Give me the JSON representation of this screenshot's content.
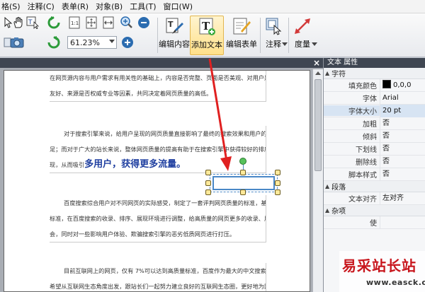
{
  "menu": [
    "格(S)",
    "注释(C)",
    "表单(R)",
    "对象(B)",
    "工具(T)",
    "窗口(W)"
  ],
  "toolbar": {
    "zoom_value": "61.23%",
    "buttons": [
      {
        "id": "edit-content",
        "label": "编辑内容"
      },
      {
        "id": "add-text",
        "label": "添加文本"
      },
      {
        "id": "edit-form",
        "label": "编辑表单"
      },
      {
        "id": "annotate",
        "label": "注释"
      },
      {
        "id": "measure",
        "label": "度量"
      }
    ]
  },
  "document": {
    "paragraphs": [
      {
        "lines": [
          "在网页源内容与用户需求有用关性的基础上，内容是否完整、页面是否美观、对用户是否",
          "友好、来源是否权威专业等因素，共同决定着网页质量的高低。"
        ]
      },
      {
        "lines": [
          "对于搜索引擎来说，给用户呈现的网页质量直接影响了最终的搜索效果和用户的需求满",
          "足；而对于广大的站长来说，整体网页质量的提高有助于在搜索引擎中获得较好的排序和展",
          "现，从而吸引"
        ],
        "highlight": "多用户，获得更多流量。"
      },
      {
        "lines": [
          "百度搜索综合用户对不同网页的实际感受，制定了一套评判网页质量的标准，基于这个",
          "标准，在百度搜索的收录、排序、展现环境进行调整，给高质量的网页更多的收录、展现机",
          "会，同时对一些影响用户体验、欺骗搜索引擎的恶劣低质网页进行打压。"
        ]
      },
      {
        "lines": [
          "目前互联网上的网页，仅有 7%可以达到高质量标准，百度作为最大的中文搜索引擎，",
          "希望从互联网生态角度出发，跟站长们一起努力建立良好的互联网生态圈，更好地为网民服"
        ]
      }
    ]
  },
  "properties": {
    "title": "文本 属性",
    "sections": [
      {
        "name": "字符",
        "rows": [
          {
            "label": "填充颜色",
            "value": "0,0,0",
            "swatch": true
          },
          {
            "label": "字体",
            "value": "Arial"
          },
          {
            "label": "字体大小",
            "value": "20 pt",
            "highlight": true
          },
          {
            "label": "加粗",
            "value": "否"
          },
          {
            "label": "倾斜",
            "value": "否"
          },
          {
            "label": "下划线",
            "value": "否"
          },
          {
            "label": "删除线",
            "value": "否"
          },
          {
            "label": "脚本样式",
            "value": "否"
          }
        ]
      },
      {
        "name": "段落",
        "rows": [
          {
            "label": "文本对齐",
            "value": "左对齐"
          }
        ]
      },
      {
        "name": "杂项",
        "rows": [
          {
            "label": "使",
            "value": ""
          }
        ]
      }
    ]
  },
  "watermark": {
    "brand": "易采站长站",
    "url": "www.easck.com"
  },
  "colors": {
    "arrow": "#e02020",
    "selection": "#4a88c7",
    "active_button": "#ffe08a"
  }
}
